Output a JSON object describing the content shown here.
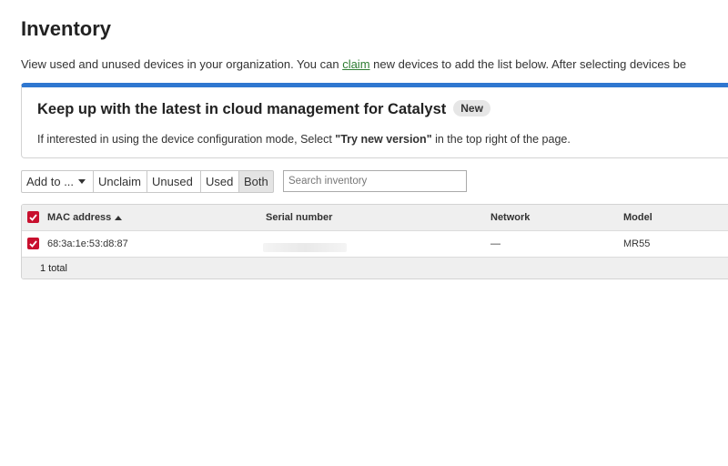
{
  "page": {
    "title": "Inventory",
    "intro_before": "View used and unused devices in your organization. You can ",
    "intro_link": "claim",
    "intro_after": " new devices to add the list below. After selecting devices be"
  },
  "banner": {
    "title": "Keep up with the latest in cloud management for Catalyst",
    "badge": "New",
    "text_before": "If interested in using the device configuration mode, Select ",
    "text_bold": "\"Try new version\"",
    "text_after": " in the top right of the page.",
    "accent_color": "#2f77d0"
  },
  "toolbar": {
    "add_to_label": "Add to ...",
    "unclaim_label": "Unclaim",
    "unused_label": "Unused",
    "used_label": "Used",
    "both_label": "Both",
    "selected_filter": "Both"
  },
  "search": {
    "placeholder": "Search inventory",
    "value": ""
  },
  "table": {
    "columns": {
      "mac": "MAC address",
      "serial": "Serial number",
      "network": "Network",
      "model": "Model"
    },
    "sort_column": "MAC address",
    "sort_direction": "ascending",
    "rows": [
      {
        "checked": true,
        "mac": "68:3a:1e:53:d8:87",
        "serial": "",
        "network": "—",
        "model": "MR55"
      }
    ],
    "footer": "1 total",
    "checkbox_color": "#c8102e"
  }
}
